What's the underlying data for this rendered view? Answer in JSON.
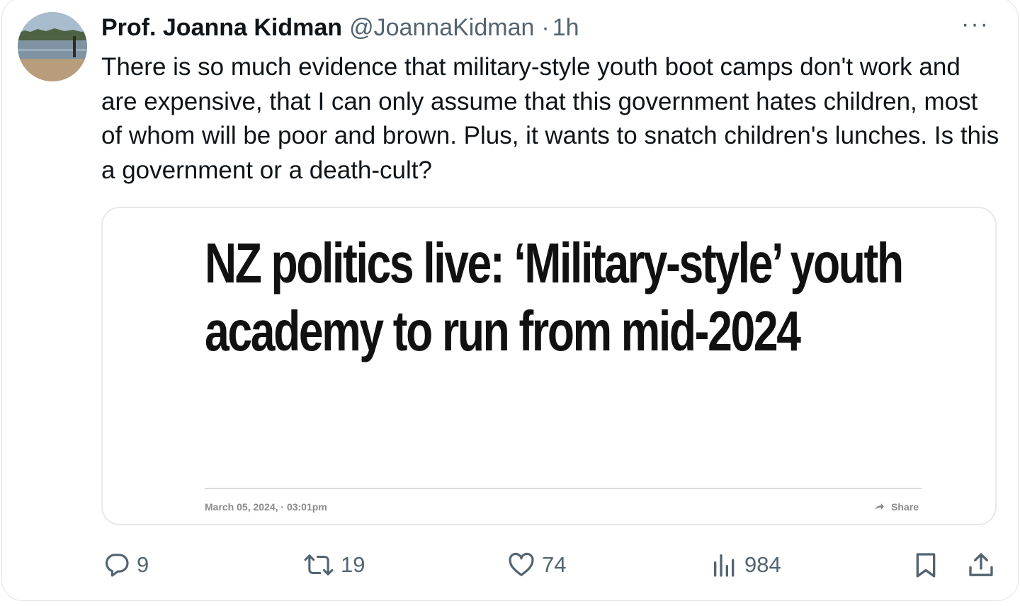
{
  "tweet": {
    "author_name": "Prof. Joanna Kidman",
    "handle": "@JoannaKidman",
    "separator": "·",
    "time": "1h",
    "more_label": "···",
    "text": "There is so much evidence that military-style youth boot camps don't work and are expensive, that I can only assume that this government hates children, most of whom will be poor and brown. Plus, it wants to snatch children's lunches. Is this a government or a death-cult?"
  },
  "card": {
    "headline": "NZ politics live: ‘Military-style’ youth academy to run from mid-2024",
    "date": "March 05, 2024, · 03:01pm",
    "share_label": "Share"
  },
  "actions": {
    "replies": "9",
    "retweets": "19",
    "likes": "74",
    "views": "984"
  },
  "icons": {
    "reply": "reply-icon",
    "retweet": "retweet-icon",
    "like": "heart-icon",
    "views": "views-chart-icon",
    "bookmark": "bookmark-icon",
    "share": "share-upload-icon"
  },
  "colors": {
    "text": "#0f1419",
    "secondary": "#536471",
    "border": "#e1e4e8"
  }
}
